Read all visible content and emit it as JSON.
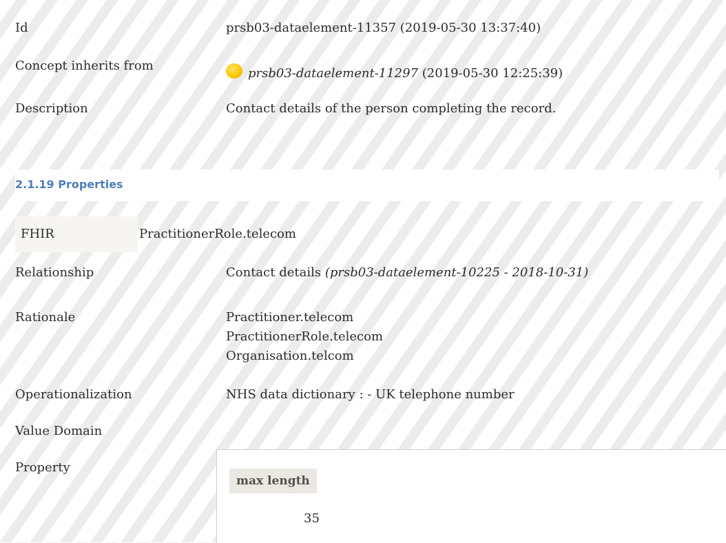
{
  "rows_top": [
    {
      "label": "Id",
      "value": "prsb03-dataelement-11357 (2019-05-30 13:37:40)"
    },
    {
      "label": "Concept inherits from",
      "value_link": "prsb03-dataelement-11297",
      "value_rest": " (2019-05-30 12:25:39)",
      "icon": "yellow-circle-icon"
    },
    {
      "label": "Description",
      "value": "Contact details of the person completing the record."
    }
  ],
  "section": {
    "title": "2.1.19 Properties"
  },
  "fhir": {
    "label": "FHIR",
    "value": "PractitionerRole.telecom"
  },
  "relationship": {
    "label": "Relationship",
    "value": "Contact details ",
    "ref": "(prsb03-dataelement-10225 - 2018-10-31)"
  },
  "rationale": {
    "label": "Rationale",
    "lines": [
      "Practitioner.telecom",
      "PractitionerRole.telecom",
      "Organisation.telcom"
    ]
  },
  "operationalization": {
    "label": "Operationalization",
    "value": "NHS data dictionary : - UK telephone number"
  },
  "value_domain": {
    "label": "Value Domain"
  },
  "property": {
    "label": "Property",
    "header": "max length",
    "value": "35"
  }
}
